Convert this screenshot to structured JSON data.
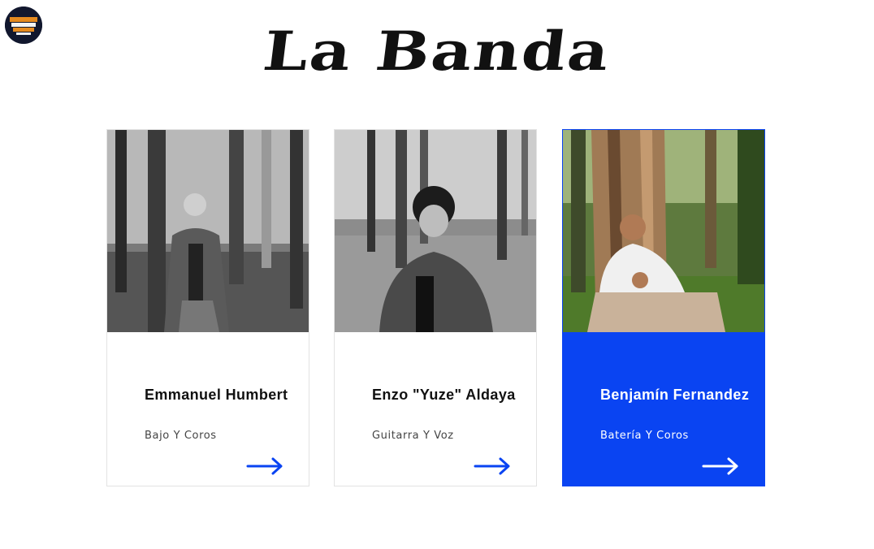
{
  "header": {
    "title": "La Banda",
    "logo_icon": "band-logo-icon"
  },
  "colors": {
    "accent": "#0a44f2",
    "text": "#111111",
    "muted": "#444444",
    "background": "#ffffff"
  },
  "members": [
    {
      "name": "Emmanuel Humbert",
      "role": "Bajo Y Coros",
      "photo": "black-and-white",
      "active": false
    },
    {
      "name": "Enzo \"Yuze\" Aldaya",
      "role": "Guitarra Y Voz",
      "photo": "black-and-white",
      "active": false
    },
    {
      "name": "Benjamín Fernandez",
      "role": "Batería Y Coros",
      "photo": "color",
      "active": true
    }
  ],
  "icons": {
    "arrow": "arrow-right-icon"
  }
}
